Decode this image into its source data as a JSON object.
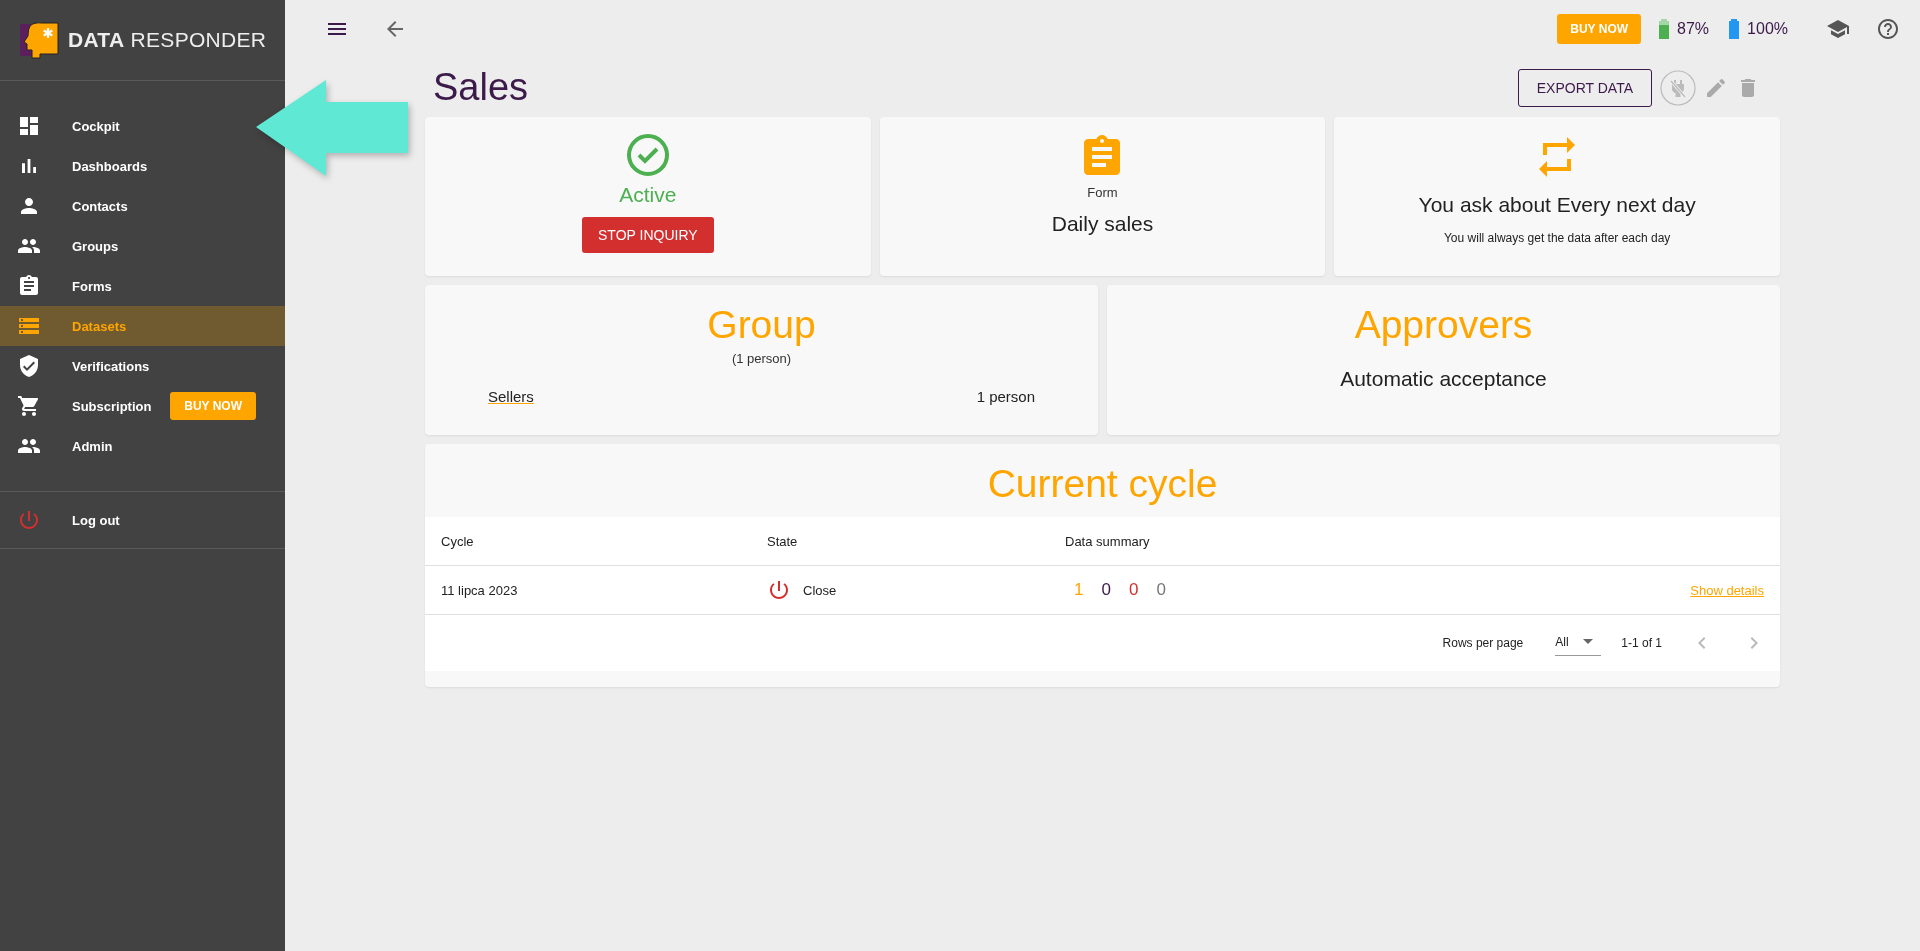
{
  "sidebar": {
    "logo": {
      "word_1": "DATA",
      "word_2": "RESPONDER"
    },
    "items": [
      {
        "label": "Cockpit",
        "selected": false
      },
      {
        "label": "Dashboards",
        "selected": false
      },
      {
        "label": "Contacts",
        "selected": false
      },
      {
        "label": "Groups",
        "selected": false
      },
      {
        "label": "Forms",
        "selected": false
      },
      {
        "label": "Datasets",
        "selected": true
      },
      {
        "label": "Verifications",
        "selected": false
      },
      {
        "label": "Subscription",
        "selected": false,
        "button": "BUY NOW"
      },
      {
        "label": "Admin",
        "selected": false
      }
    ],
    "logout": {
      "label": "Log out"
    }
  },
  "topbar": {
    "buy_button": "BUY NOW",
    "battery_1": "87%",
    "battery_2": "100%"
  },
  "header": {
    "title": "Sales",
    "export_button": "EXPORT DATA"
  },
  "status_card": {
    "status": "Active",
    "stop_button": "STOP INQUIRY"
  },
  "form_card": {
    "label": "Form",
    "name": "Daily sales"
  },
  "schedule_card": {
    "title": "You ask about Every next day",
    "note": "You will always get the data after each day"
  },
  "group_card": {
    "title": "Group",
    "count": "(1 person)",
    "members": [
      {
        "name": "Sellers",
        "count": "1 person"
      }
    ]
  },
  "approvers_card": {
    "title": "Approvers",
    "value": "Automatic acceptance"
  },
  "cycle_table": {
    "title": "Current cycle",
    "columns": [
      "Cycle",
      "State",
      "Data summary"
    ],
    "rows": [
      {
        "cycle": "11 lipca 2023",
        "state": "Close",
        "summary": [
          {
            "value": "1",
            "color": "#ffa500"
          },
          {
            "value": "0",
            "color": "#3c1a4a"
          },
          {
            "value": "0",
            "color": "#d32f2f"
          },
          {
            "value": "0",
            "color": "#777777"
          }
        ],
        "link": "Show details"
      }
    ],
    "footer": {
      "rows_per_page_label": "Rows per page",
      "rows_per_page_value": "All",
      "range": "1-1 of 1"
    }
  }
}
